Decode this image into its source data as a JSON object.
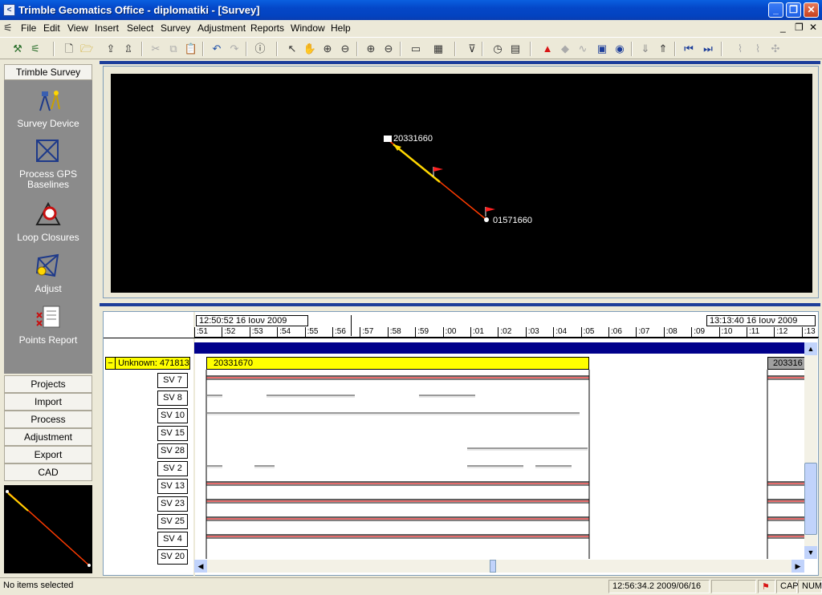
{
  "window": {
    "title": "Trimble Geomatics Office - diplomatiki - [Survey]",
    "app_icon": "trimble-logo-icon"
  },
  "menu": [
    "File",
    "Edit",
    "View",
    "Insert",
    "Select",
    "Survey",
    "Adjustment",
    "Reports",
    "Window",
    "Help"
  ],
  "left_panel": {
    "header": "Trimble Survey",
    "tools": [
      {
        "label": "Survey Device",
        "icon": "survey-device-icon"
      },
      {
        "label": "Process GPS\nBaselines",
        "icon": "process-gps-baselines-icon"
      },
      {
        "label": "Loop Closures",
        "icon": "loop-closures-icon"
      },
      {
        "label": "Adjust",
        "icon": "adjust-icon"
      },
      {
        "label": "Points Report",
        "icon": "points-report-icon"
      }
    ],
    "nav": [
      "Projects",
      "Import",
      "Process",
      "Adjustment",
      "Export",
      "CAD"
    ]
  },
  "plan_view": {
    "points": [
      {
        "id": "20331660"
      },
      {
        "id": "01571660"
      }
    ]
  },
  "timeline": {
    "start_time": "12:50:52 16 Ιουν 2009",
    "end_time": "13:13:40 16 Ιουν 2009",
    "ticks": [
      ":51",
      ":52",
      ":53",
      ":54",
      ":55",
      ":56",
      ":57",
      ":58",
      ":59",
      ":00",
      ":01",
      ":02",
      ":03",
      ":04",
      ":05",
      ":06",
      ":07",
      ":08",
      ":09",
      ":10",
      ":11",
      ":12",
      ":13"
    ],
    "group_label": "Unknown: 471813",
    "occupation_1": "20331670",
    "occupation_2": "203316",
    "satellites": [
      "SV 7",
      "SV 8",
      "SV 10",
      "SV 15",
      "SV 28",
      "SV 2",
      "SV 13",
      "SV 23",
      "SV 25",
      "SV 4",
      "SV 20"
    ]
  },
  "status": {
    "selection": "No items selected",
    "datetime": "12:56:34.2  2009/06/16",
    "caps": "CAP",
    "num": "NUM"
  },
  "colors": {
    "title_bar": "#0447c8",
    "sidebar_tools_bg": "#8b8b8b",
    "plan_bg": "#000000",
    "occupation_bar": "#ffff00",
    "time_band": "#00008b",
    "baseline": "#ff3b00"
  }
}
